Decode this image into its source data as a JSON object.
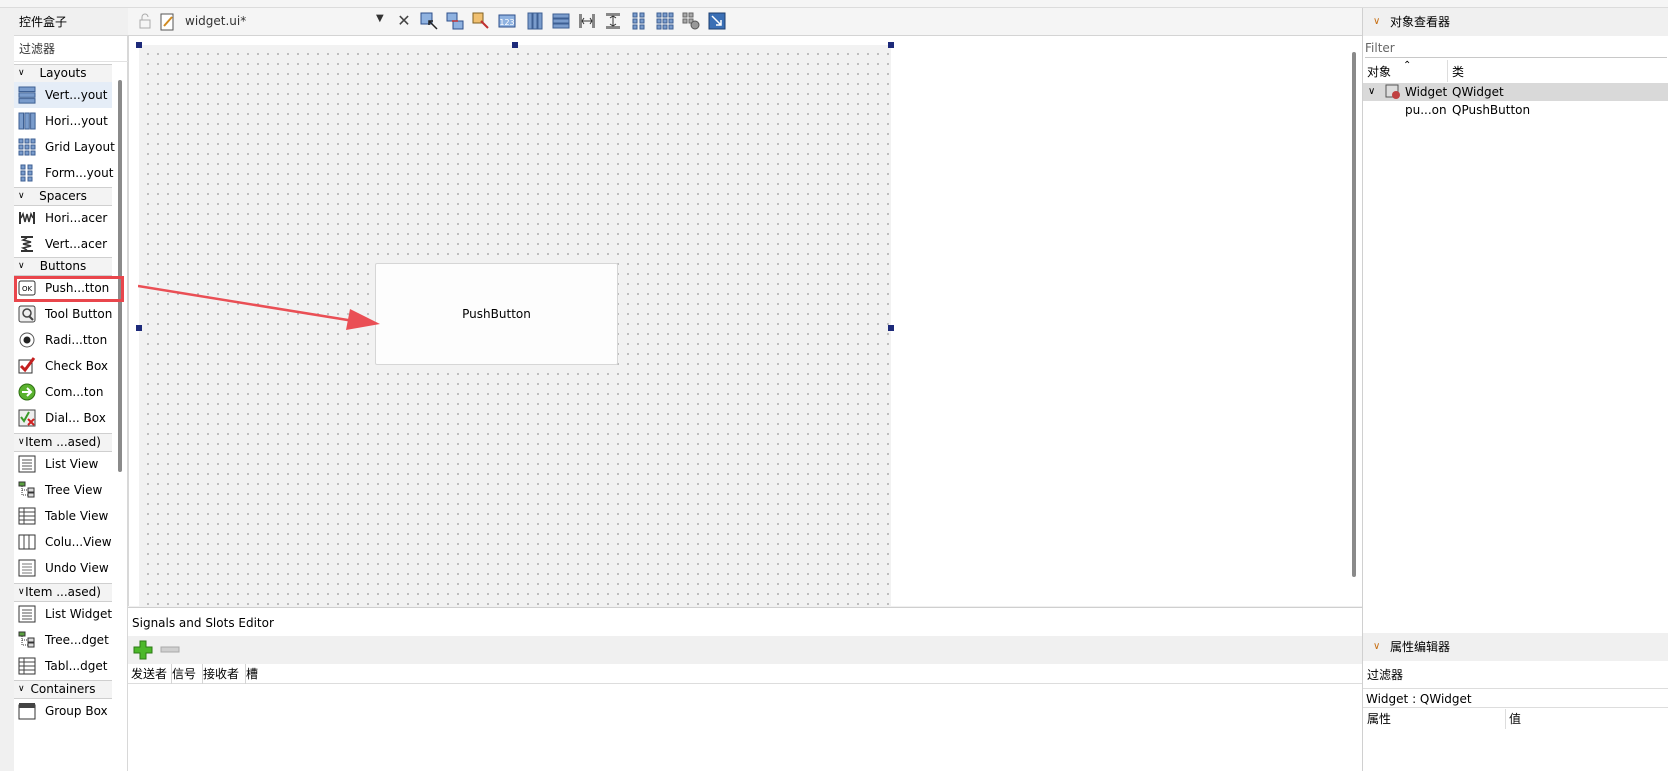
{
  "widget_box": {
    "title": "控件盒子",
    "filter_label": "过滤器",
    "categories": [
      {
        "label": "Layouts"
      },
      {
        "label": "Spacers"
      },
      {
        "label": "Buttons"
      },
      {
        "label": "Item ...ased)"
      },
      {
        "label": "Item ...ased)"
      },
      {
        "label": "Containers"
      }
    ],
    "items": [
      {
        "label": "Vert...yout",
        "icon": "vertical-layout-icon"
      },
      {
        "label": "Hori...yout",
        "icon": "horizontal-layout-icon"
      },
      {
        "label": "Grid Layout",
        "icon": "grid-layout-icon"
      },
      {
        "label": "Form...yout",
        "icon": "form-layout-icon"
      },
      {
        "label": "Hori...acer",
        "icon": "horizontal-spacer-icon"
      },
      {
        "label": "Vert...acer",
        "icon": "vertical-spacer-icon"
      },
      {
        "label": "Push...tton",
        "icon": "push-button-icon"
      },
      {
        "label": "Tool Button",
        "icon": "tool-button-icon"
      },
      {
        "label": "Radi...tton",
        "icon": "radio-button-icon"
      },
      {
        "label": "Check Box",
        "icon": "check-box-icon"
      },
      {
        "label": "Com...ton",
        "icon": "command-link-icon"
      },
      {
        "label": "Dial... Box",
        "icon": "dialog-button-box-icon"
      },
      {
        "label": "List View",
        "icon": "list-view-icon"
      },
      {
        "label": "Tree View",
        "icon": "tree-view-icon"
      },
      {
        "label": "Table View",
        "icon": "table-view-icon"
      },
      {
        "label": "Colu...View",
        "icon": "column-view-icon"
      },
      {
        "label": "Undo View",
        "icon": "undo-view-icon"
      },
      {
        "label": "List Widget",
        "icon": "list-widget-icon"
      },
      {
        "label": "Tree...dget",
        "icon": "tree-widget-icon"
      },
      {
        "label": "Tabl...dget",
        "icon": "table-widget-icon"
      },
      {
        "label": "Group Box",
        "icon": "group-box-icon"
      }
    ]
  },
  "toolbar": {
    "file_name": "widget.ui*"
  },
  "form": {
    "push_button_text": "PushButton"
  },
  "signals_slots": {
    "title": "Signals and Slots Editor",
    "columns": [
      "发送者",
      "信号",
      "接收者",
      "槽"
    ]
  },
  "object_inspector": {
    "title": "对象查看器",
    "filter_placeholder": "Filter",
    "columns": [
      "对象",
      "类"
    ],
    "rows": [
      {
        "object": "Widget",
        "class": "QWidget"
      },
      {
        "object": "pu...on",
        "class": "QPushButton"
      }
    ]
  },
  "property_editor": {
    "title": "属性编辑器",
    "filter_label": "过滤器",
    "context": "Widget : QWidget",
    "columns": [
      "属性",
      "值"
    ]
  },
  "colors": {
    "accent_selection": "#e5edf7",
    "annotation_red": "#e9464c",
    "handle_blue": "#1d2a7a"
  }
}
